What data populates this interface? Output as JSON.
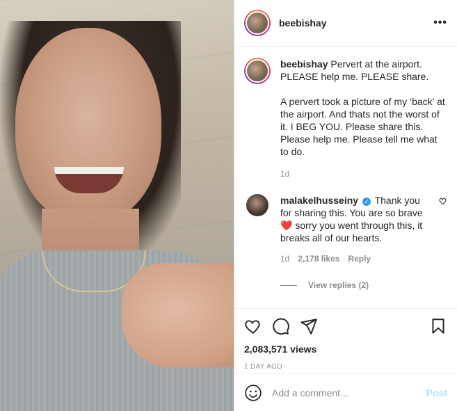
{
  "header": {
    "username": "beebishay",
    "more_label": "•••"
  },
  "caption": {
    "username": "beebishay",
    "text": "Pervert at the airport. PLEASE help me. PLEASE share.\n\nA pervert took a picture of my ‘back’ at the airport. And thats not the worst of it. I BEG YOU. Please share this. Please help me. Please tell me what to do.",
    "time": "1d"
  },
  "comment": {
    "username": "malakelhusseiny",
    "verified_mark": "✓",
    "text_before": "Thank you for sharing this. You are so brave",
    "heart": "❤️",
    "text_after": "sorry you went through this, it breaks all of our hearts.",
    "time": "1d",
    "likes": "2,178 likes",
    "reply_label": "Reply",
    "view_replies": "View replies (2)"
  },
  "stats": {
    "views": "2,083,571 views",
    "time_ago": "1 DAY AGO"
  },
  "add_comment": {
    "placeholder": "Add a comment...",
    "post_label": "Post"
  },
  "colors": {
    "link_blue": "#b2dffc",
    "verified": "#3897f0",
    "heart": "#ed4956",
    "muted": "#8e8e8e"
  },
  "icons": [
    "heart-icon",
    "comment-icon",
    "share-icon",
    "bookmark-icon",
    "emoji-icon",
    "verified-icon",
    "like-comment-icon"
  ]
}
